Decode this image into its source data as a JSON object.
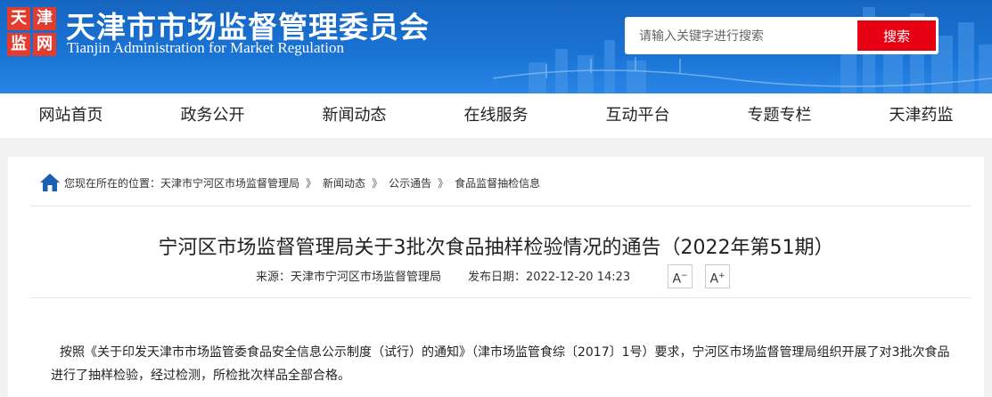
{
  "header": {
    "logo_chars": [
      "天",
      "津",
      "监",
      "网"
    ],
    "title": "天津市市场监督管理委员会",
    "subtitle": "Tianjin Administration for Market Regulation"
  },
  "search": {
    "placeholder": "请输入关键字进行搜索",
    "button_label": "搜索"
  },
  "nav": {
    "items": [
      {
        "label": "网站首页"
      },
      {
        "label": "政务公开"
      },
      {
        "label": "新闻动态"
      },
      {
        "label": "在线服务"
      },
      {
        "label": "互动平台"
      },
      {
        "label": "专题专栏"
      },
      {
        "label": "天津药监"
      }
    ]
  },
  "breadcrumb": {
    "prefix": "您现在所在的位置：",
    "items": [
      {
        "label": "天津市宁河区市场监督管理局"
      },
      {
        "label": "新闻动态"
      },
      {
        "label": "公示通告"
      },
      {
        "label": "食品监督抽检信息"
      }
    ],
    "separator": "》"
  },
  "article": {
    "title": "宁河区市场监督管理局关于3批次食品抽样检验情况的通告（2022年第51期）",
    "source": "来源：天津市宁河区市场监督管理局",
    "date": "发布日期：2022-12-20 14:23",
    "font_smaller": "A",
    "font_smaller_mark": "−",
    "font_larger": "A",
    "font_larger_mark": "+",
    "paragraph": "按照《关于印发天津市市场监管委食品安全信息公示制度（试行）的通知》（津市场监管食综〔2017〕1号）要求，宁河区市场监督管理局组织开展了对3批次食品进行了抽样检验，经过检测，所检批次样品全部合格。"
  },
  "colors": {
    "header_blue": "#1a6fd0",
    "search_red": "#e60012",
    "logo_red": "#e33b2e"
  }
}
